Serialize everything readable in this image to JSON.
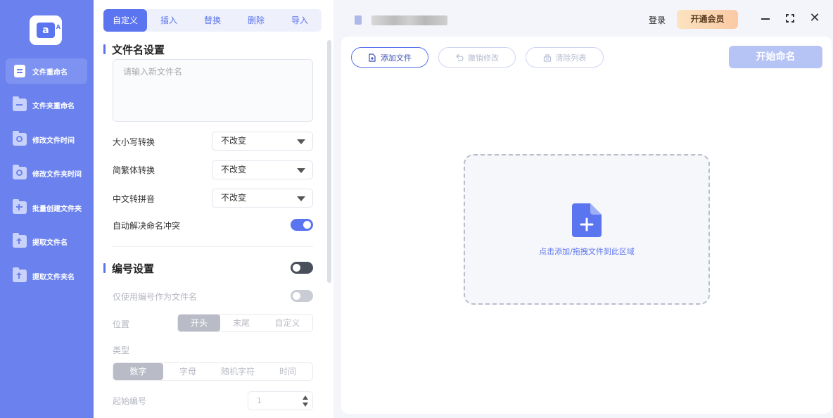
{
  "sidebar": {
    "logo_icon": "app-logo-icon",
    "items": [
      {
        "label": "文件重命名",
        "icon": "document-icon",
        "active": true
      },
      {
        "label": "文件夹重命名",
        "icon": "folder-rename-icon"
      },
      {
        "label": "修改文件时间",
        "icon": "file-clock-icon"
      },
      {
        "label": "修改文件夹时间",
        "icon": "folder-clock-icon"
      },
      {
        "label": "批量创建文件夹",
        "icon": "folder-plus-icon"
      },
      {
        "label": "提取文件名",
        "icon": "extract-upload-icon"
      },
      {
        "label": "提取文件夹名",
        "icon": "folder-extract-icon"
      }
    ]
  },
  "tabs": [
    "自定义",
    "插入",
    "替换",
    "删除",
    "导入"
  ],
  "filename_settings": {
    "title": "文件名设置",
    "placeholder": "请输入新文件名",
    "rows": [
      {
        "label": "大小写转换",
        "value": "不改变"
      },
      {
        "label": "简繁体转换",
        "value": "不改变"
      },
      {
        "label": "中文转拼音",
        "value": "不改变"
      }
    ],
    "auto_resolve_label": "自动解决命名冲突"
  },
  "numbering": {
    "title": "编号设置",
    "only_number_label": "仅使用编号作为文件名",
    "position_label": "位置",
    "position_options": [
      "开头",
      "末尾",
      "自定义"
    ],
    "type_label": "类型",
    "type_options": [
      "数字",
      "字母",
      "随机字符",
      "时间"
    ],
    "start_label": "起始编号",
    "start_value": "1"
  },
  "topbar": {
    "login": "登录",
    "vip": "开通会员"
  },
  "toolbar": {
    "add_file": "添加文件",
    "undo": "撤销修改",
    "clear": "清除列表",
    "start": "开始命名"
  },
  "dropzone": {
    "text": "点击添加/拖拽文件到此区域"
  },
  "colors": {
    "accent": "#5b74ef",
    "sidebar": "#6b82ee"
  }
}
